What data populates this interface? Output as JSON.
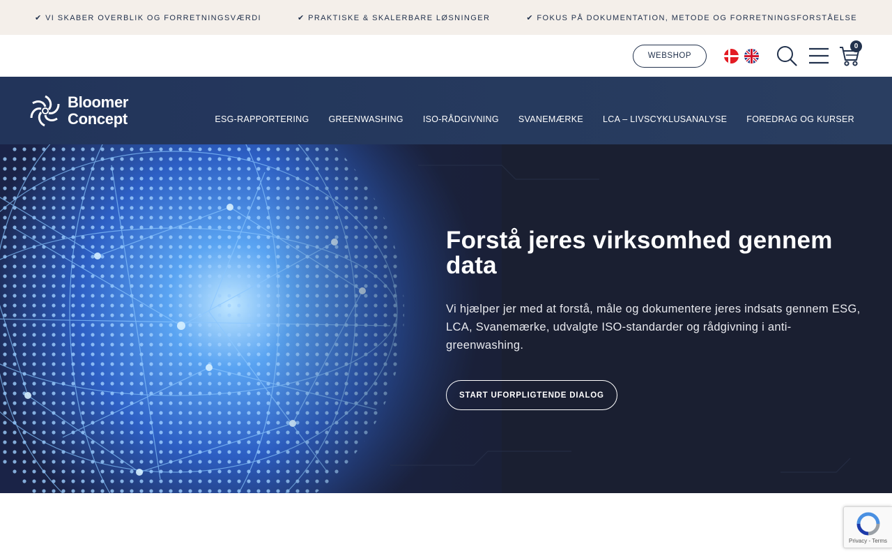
{
  "topbar": {
    "benefits": [
      "✔ Vi skaber overblik og forretningsværdi",
      "✔ Praktiske & skalerbare løsninger",
      "✔ Fokus på dokumentation, metode og forretningsforståelse"
    ]
  },
  "utility": {
    "webshop_label": "WEBSHOP",
    "languages": [
      "danish-flag-icon",
      "uk-flag-icon"
    ],
    "icons": [
      "search-icon",
      "menu-icon",
      "cart-icon"
    ],
    "cart_count": "0"
  },
  "brand": {
    "name_line1": "Bloomer",
    "name_line2": "Concept"
  },
  "nav": {
    "items": [
      "ESG-RAPPORTERING",
      "GREENWASHING",
      "ISO-RÅDGIVNING",
      "SVANEMÆRKE",
      "LCA – LIVSCYKLUSANALYSE",
      "FOREDRAG OG KURSER"
    ]
  },
  "hero": {
    "title": "Forstå jeres virksomhed gennem data",
    "text": "Vi hjælper jer med at forstå, måle og dokumentere jeres indsats gennem ESG, LCA, Svanemærke, udvalgte ISO-standarder og rådgivning i anti-greenwashing.",
    "cta_label": "START UFORPLIGTENDE DIALOG"
  },
  "recaptcha": {
    "links": "Privacy - Terms"
  },
  "colors": {
    "brand_navy": "#22324d",
    "topbar_bg": "#f4efea",
    "hero_bg": "#1a1f31"
  }
}
